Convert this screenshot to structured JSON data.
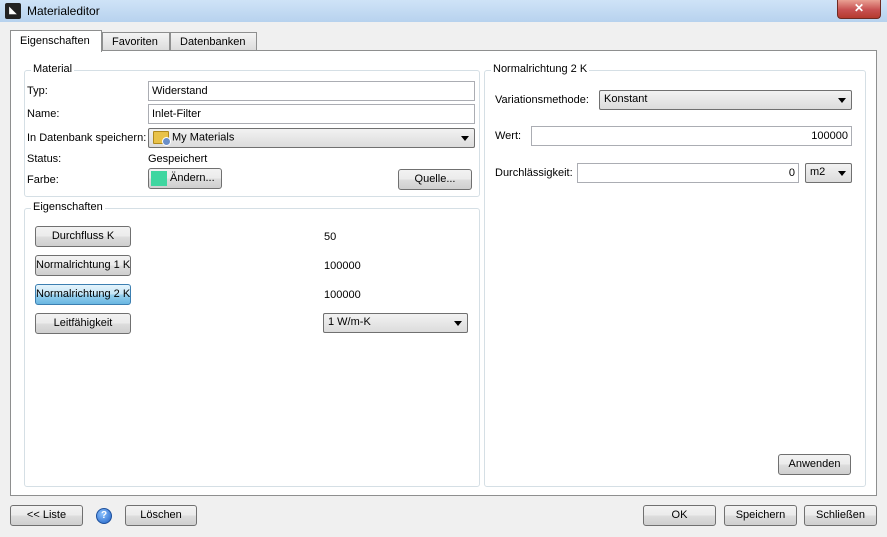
{
  "window": {
    "title": "Materialeditor",
    "close_label": "✕"
  },
  "tabs": [
    {
      "label": "Eigenschaften",
      "active": true
    },
    {
      "label": "Favoriten",
      "active": false
    },
    {
      "label": "Datenbanken",
      "active": false
    }
  ],
  "material": {
    "legend": "Material",
    "typ_label": "Typ:",
    "typ_value": "Widerstand",
    "name_label": "Name:",
    "name_value": "Inlet-Filter",
    "db_label": "In Datenbank speichern:",
    "db_value": "My Materials",
    "status_label": "Status:",
    "status_value": "Gespeichert",
    "farbe_label": "Farbe:",
    "farbe_button": "Ändern...",
    "farbe_color": "#3fd6a0",
    "quelle_button": "Quelle..."
  },
  "eigenschaften": {
    "legend": "Eigenschaften",
    "rows": [
      {
        "button": "Durchfluss K",
        "value": "50"
      },
      {
        "button": "Normalrichtung 1 K",
        "value": "100000"
      },
      {
        "button": "Normalrichtung 2 K",
        "value": "100000"
      },
      {
        "button": "Leitfähigkeit",
        "value": "1 W/m-K"
      }
    ]
  },
  "normal2": {
    "legend": "Normalrichtung 2 K",
    "variation_label": "Variationsmethode:",
    "variation_value": "Konstant",
    "wert_label": "Wert:",
    "wert_value": "100000",
    "durch_label": "Durchlässigkeit:",
    "durch_value": "0",
    "durch_unit": "m2",
    "anwenden_button": "Anwenden"
  },
  "footer": {
    "liste_button": "<< Liste",
    "help_icon": "?",
    "loeschen_button": "Löschen",
    "ok_button": "OK",
    "speichern_button": "Speichern",
    "schliessen_button": "Schließen"
  }
}
